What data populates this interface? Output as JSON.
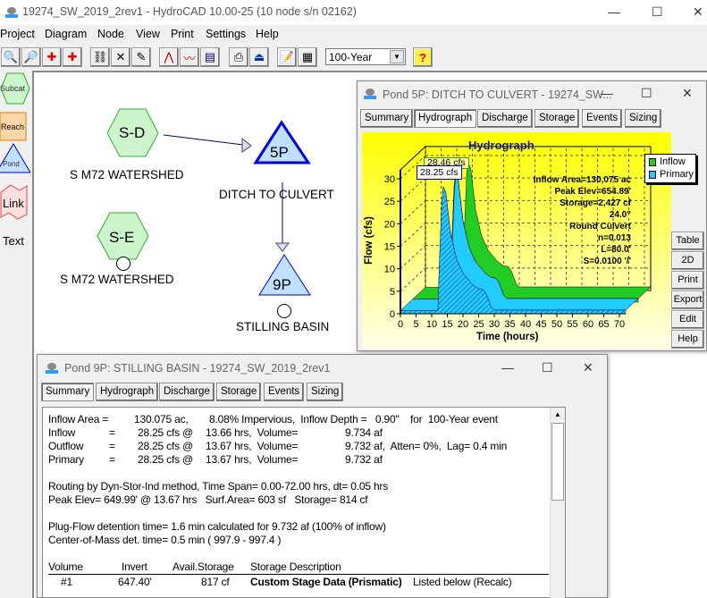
{
  "app": {
    "title": "19274_SW_2019_2rev1 - HydroCAD 10.00-25 (10 node s/n 02162)",
    "menu": [
      "Project",
      "Diagram",
      "Node",
      "View",
      "Print",
      "Settings",
      "Help"
    ],
    "toolbar": {
      "icons": [
        "zoom-in-icon",
        "zoom-out-icon",
        "fit-icon",
        "expand-icon",
        "find-icon",
        "delete-icon",
        "edit-icon",
        "hydrograph-icon",
        "graph-icon",
        "table-icon",
        "print-icon",
        "print-preview-icon",
        "report-icon",
        "calculator-icon"
      ],
      "event": "100-Year",
      "help": "?"
    }
  },
  "palette": [
    "Subcat",
    "Reach",
    "Pond",
    "Link",
    "Text"
  ],
  "diagram": {
    "nodes": [
      {
        "id": "S-D",
        "label": "S M72 WATERSHED",
        "type": "subcat"
      },
      {
        "id": "S-E",
        "label": "S M72 WATERSHED",
        "type": "subcat"
      },
      {
        "id": "5P",
        "label": "DITCH TO CULVERT",
        "type": "pond"
      },
      {
        "id": "9P",
        "label": "STILLING BASIN",
        "type": "pond"
      }
    ]
  },
  "pond5p": {
    "title": "Pond 5P: DITCH TO CULVERT - 19274_SW...",
    "tabs": [
      "Summary",
      "Hydrograph",
      "Discharge",
      "Storage",
      "Events",
      "Sizing"
    ],
    "side_buttons": [
      "Table",
      "2D",
      "Print",
      "Export",
      "Edit",
      "Help"
    ],
    "colors": {
      "inflow": "#22cc22",
      "primary": "#22ccff",
      "background": "#ffff00"
    }
  },
  "chart_data": {
    "type": "area",
    "title": "Hydrograph",
    "xlabel": "Time  (hours)",
    "ylabel": "Flow  (cfs)",
    "xlim": [
      0,
      72
    ],
    "ylim": [
      0,
      32
    ],
    "xticks": [
      "0",
      "5",
      "10",
      "15",
      "20",
      "25",
      "30",
      "35",
      "40",
      "45",
      "50",
      "55",
      "60",
      "65",
      "70"
    ],
    "yticks": [
      "0",
      "5",
      "10",
      "15",
      "20",
      "25",
      "30"
    ],
    "legend": [
      "Inflow",
      "Primary"
    ],
    "legend_position": "top-right",
    "grid": true,
    "x": [
      0,
      12,
      12.5,
      13.2,
      13.7,
      14.5,
      16,
      18,
      20,
      23,
      25,
      26.5,
      27.5,
      29,
      30,
      72
    ],
    "series": [
      {
        "name": "Inflow",
        "values": [
          0.7,
          0.7,
          14,
          26,
          28.46,
          27,
          18,
          12,
          9,
          6.5,
          5.5,
          5.3,
          4.3,
          1.5,
          0.8,
          0.8
        ]
      },
      {
        "name": "Primary",
        "values": [
          0.7,
          0.7,
          12,
          24,
          28.25,
          27,
          18,
          12,
          9,
          6.5,
          5.5,
          5.3,
          4.3,
          1.5,
          0.8,
          0.8
        ]
      }
    ],
    "annotations": [
      "28.46 cfs",
      "28.25 cfs"
    ],
    "info": [
      "Inflow Area=130,075 ac",
      "Peak Elev=654.89'",
      "Storage=2,427 cf",
      "24.0\"",
      "Round Culvert",
      "n=0.013",
      "L=80.0'",
      "S=0.0100 '/'"
    ]
  },
  "pond9p": {
    "title": "Pond 9P: STILLING BASIN - 19274_SW_2019_2rev1",
    "tabs": [
      "Summary",
      "Hydrograph",
      "Discharge",
      "Storage",
      "Events",
      "Sizing"
    ],
    "summary": [
      [
        "Inflow Area =",
        "130.075 ac,",
        "8.08% Impervious,  Inflow Depth =   0.90\"    for  100-Year event"
      ],
      [
        "Inflow",
        "=",
        "28.25 cfs @",
        "13.66 hrs,  Volume=",
        "9.734 af"
      ],
      [
        "Outflow",
        "=",
        "28.25 cfs @",
        "13.67 hrs,  Volume=",
        "9.732 af,  Atten= 0%,  Lag= 0.4 min"
      ],
      [
        "Primary",
        "=",
        "28.25 cfs @",
        "13.67 hrs,  Volume=",
        "9.732 af"
      ]
    ],
    "routing": [
      "Routing by Dyn-Stor-Ind method, Time Span= 0.00-72.00 hrs, dt= 0.05 hrs",
      "Peak Elev= 649.99' @ 13.67 hrs   Surf.Area= 603 sf   Storage= 814 cf"
    ],
    "detention": [
      "Plug-Flow detention time= 1.6 min calculated for 9.732 af (100% of inflow)",
      "Center-of-Mass det. time= 0.5 min ( 997.9 - 997.4 )"
    ],
    "table_headers": [
      "Volume",
      "Invert",
      "Avail.Storage",
      "Storage Description"
    ],
    "table_rows": [
      [
        "#1",
        "647.40'",
        "817 cf",
        "Custom Stage Data (Prismatic)",
        "Listed below (Recalc)"
      ]
    ]
  }
}
